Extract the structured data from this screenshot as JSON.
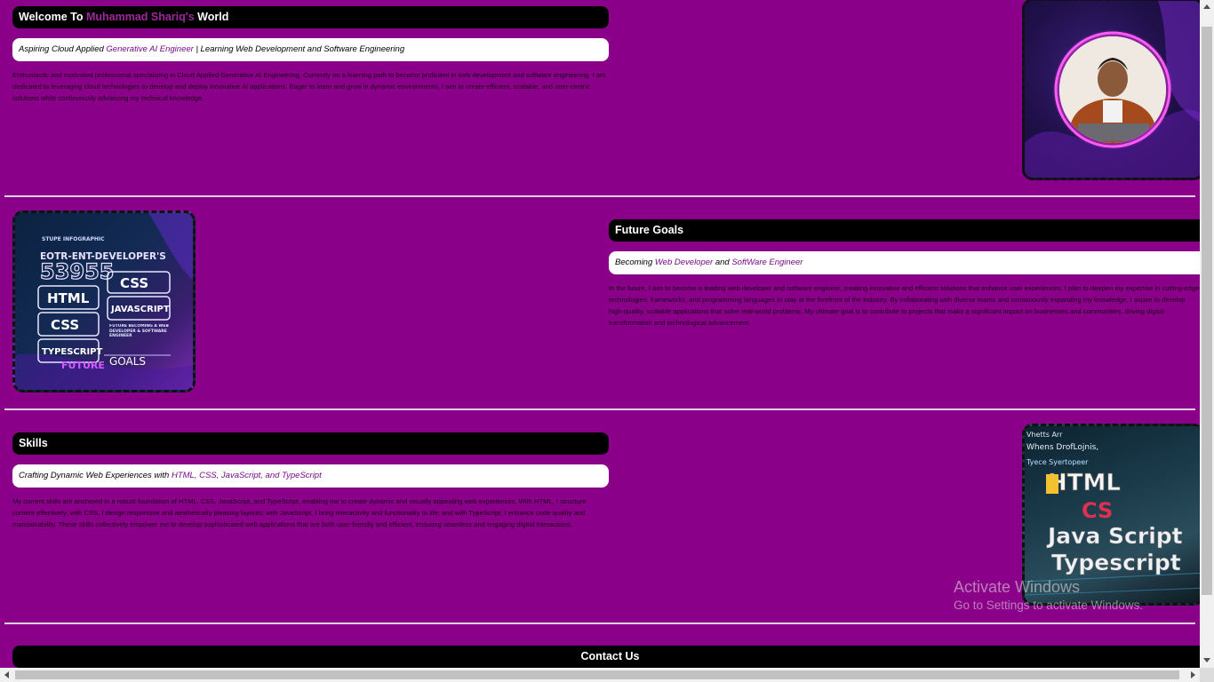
{
  "hero": {
    "title_prefix": "Welcome To ",
    "title_name": "Muhammad Shariq's",
    "title_suffix": " World",
    "subtitle_prefix": "Aspiring Cloud Applied ",
    "subtitle_highlight": "Generative AI Engineer",
    "subtitle_suffix": " | Learning Web Development and Software Engineering",
    "paragraph": "Enthusiastic and motivated professional specializing in Cloud Applied Generative AI Engineering. Currently on a learning path to become proficient in web development and software engineering. I am dedicated to leveraging cloud technologies to develop and deploy innovative AI applications. Eager to learn and grow in dynamic environments, I aim to create efficient, scalable, and user-centric solutions while continuously advancing my technical knowledge."
  },
  "goals": {
    "title": "Future Goals",
    "subtitle_prefix": "Becoming ",
    "subtitle_h1": "Web Developer",
    "subtitle_mid": " and ",
    "subtitle_h2": "SoftWare Engineer",
    "paragraph": "In the future, I aim to become a leading web developer and software engineer, creating innovative and efficient solutions that enhance user experiences. I plan to deepen my expertise in cutting-edge technologies, frameworks, and programming languages to stay at the forefront of the industry. By collaborating with diverse teams and continuously expanding my knowledge, I aspire to develop high-quality, scalable applications that solve real-world problems. My ultimate goal is to contribute to projects that make a significant impact on businesses and communities, driving digital transformation and technological advancement.",
    "image": {
      "line1": "STUPE INFOGRAPHIC",
      "line2": "EOTR-ENT-DEVELOPER'S",
      "line3": "53955",
      "tag_html": "HTML",
      "tag_css": "CSS",
      "tag_css2": "CSS",
      "tag_js": "JAVASCRIPT",
      "tag_ts": "TYPESCRIPT",
      "note": "FUTURE BECOMING A WEB DEVELOPER & SOFTWARE ENGINEER",
      "footer1": "FUTURE",
      "footer2": "GOALS"
    }
  },
  "skills": {
    "title": "Skills",
    "subtitle_prefix": "Crafting Dynamic Web Experiences with ",
    "subtitle_highlight": "HTML, CSS, JavaScript, and TypeScript",
    "paragraph": "My current skills are anchored in a robust foundation of HTML, CSS, JavaScript, and TypeScript, enabling me to create dynamic and visually appealing web experiences. With HTML, I structure content effectively; with CSS, I design responsive and aesthetically pleasing layouts; with JavaScript, I bring interactivity and functionality to life; and with TypeScript, I enhance code quality and maintainability. These skills collectively empower me to develop sophisticated web applications that are both user-friendly and efficient, ensuring seamless and engaging digital interactions.",
    "image": {
      "t1": "Vhetts Arr",
      "t2": "Whens DrofLojnis,",
      "t3": "Tyece Syertopeer",
      "w1": "HTML",
      "w2": "CS",
      "w3": "Java Script",
      "w4": "Typescript"
    }
  },
  "contact": {
    "title": "Contact Us"
  },
  "watermark": {
    "line1": "Activate Windows",
    "line2": "Go to Settings to activate Windows."
  },
  "colors": {
    "background": "#8b0089",
    "bar": "#000000",
    "accent": "#a0279b"
  }
}
